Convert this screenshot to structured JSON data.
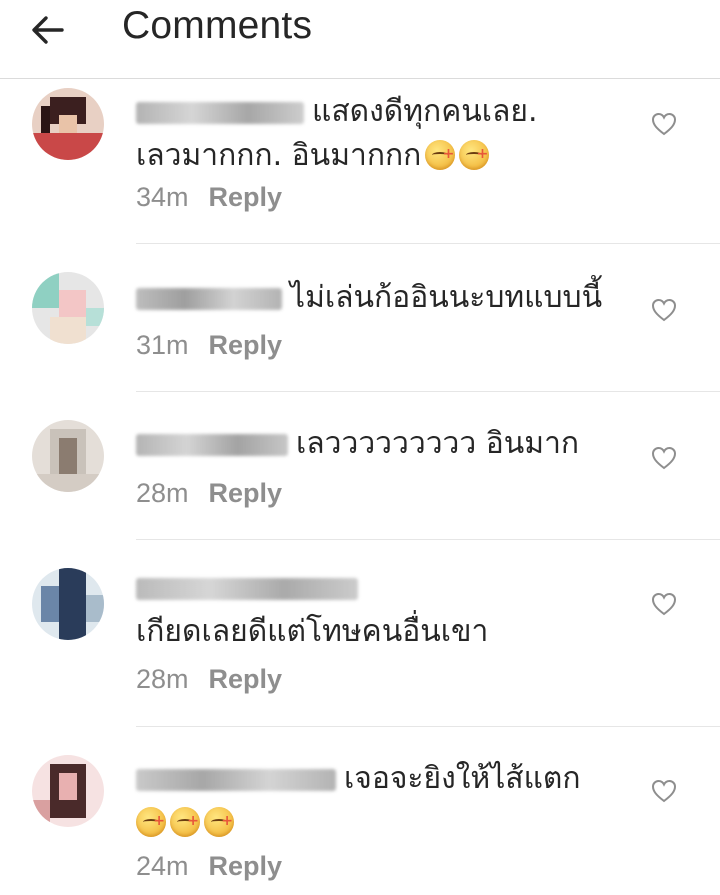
{
  "header": {
    "title": "Comments",
    "back_icon": "arrow-left-icon"
  },
  "comments": [
    {
      "text_line1": "แสดงดีทุกคนเลย.",
      "text_line2": "เลวมากกก. อินมากกก",
      "time": "34m",
      "reply": "Reply",
      "emoji_count": 2,
      "avatar_colors": [
        "#3b1f1f",
        "#c94848",
        "#e8d0c4"
      ]
    },
    {
      "text_line1": "ไม่เล่นก้ออินนะบทแบบนี้",
      "text_line2": "",
      "time": "31m",
      "reply": "Reply",
      "emoji_count": 0,
      "avatar_colors": [
        "#8fd0c2",
        "#f3c6c6",
        "#e6e6e6"
      ]
    },
    {
      "text_line1": "เลววววววววว อินมาก",
      "text_line2": "",
      "time": "28m",
      "reply": "Reply",
      "emoji_count": 0,
      "avatar_colors": [
        "#c9c2ba",
        "#8b7c70",
        "#e4ded8"
      ]
    },
    {
      "text_line1": "เกียดเลยดีแต่โทษคนอื่นเขา",
      "text_line2": "",
      "time": "28m",
      "reply": "Reply",
      "emoji_count": 0,
      "avatar_colors": [
        "#2a3c5a",
        "#dfe8ee",
        "#6b86a8"
      ]
    },
    {
      "text_line1": "เจอจะยิงให้ไส้แตก",
      "text_line2": "",
      "time": "24m",
      "reply": "Reply",
      "emoji_count": 3,
      "avatar_colors": [
        "#4a2a2a",
        "#e8b0b0",
        "#f6e2e2"
      ]
    }
  ],
  "colors": {
    "text": "#262626",
    "meta": "#8e8e8e",
    "divider": "#e6e6e6"
  }
}
